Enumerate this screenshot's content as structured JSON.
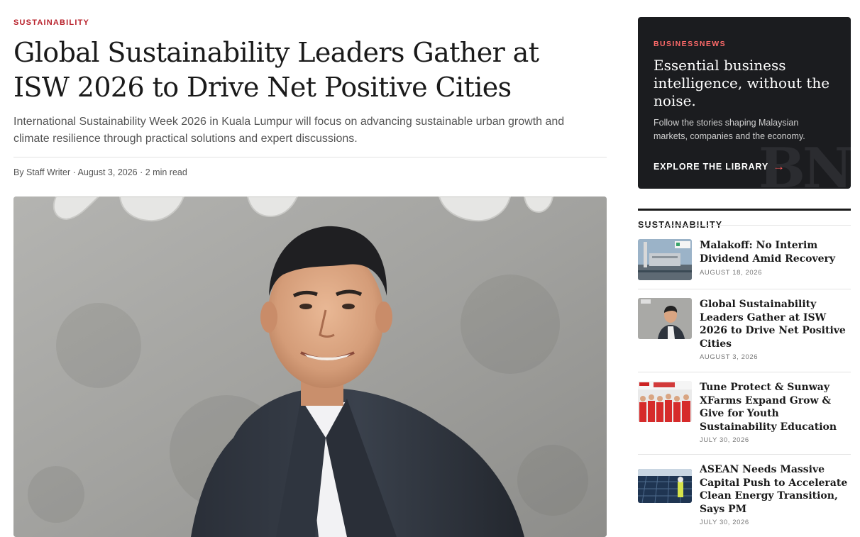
{
  "article": {
    "kicker": "SUSTAINABILITY",
    "headline": "Global Sustainability Leaders Gather at ISW 2026 to Drive Net Positive Cities",
    "dek": "International Sustainability Week 2026 in Kuala Lumpur will focus on advancing sustainable urban growth and climate resilience through practical solutions and expert discussions.",
    "byline": "By Staff Writer · August 3, 2026 · 2 min read"
  },
  "promo": {
    "brand": "BUSINESSNEWS",
    "title": "Essential business intelligence, without the noise.",
    "text": "Follow the stories shaping Malaysian markets, companies and the economy.",
    "cta": "EXPLORE THE LIBRARY",
    "cta_arrow": "→",
    "watermark": "BN"
  },
  "sidebar": {
    "section_label": "SUSTAINABILITY",
    "items": [
      {
        "title": "Malakoff: No Interim Dividend Amid Recovery",
        "date": "AUGUST 18, 2026"
      },
      {
        "title": "Global Sustainability Leaders Gather at ISW 2026 to Drive Net Positive Cities",
        "date": "AUGUST 3, 2026"
      },
      {
        "title": "Tune Protect & Sunway XFarms Expand Grow & Give for Youth Sustainability Education",
        "date": "JULY 30, 2026"
      },
      {
        "title": "ASEAN Needs Massive Capital Push to Accelerate Clean Energy Transition, Says PM",
        "date": "JULY 30, 2026"
      }
    ]
  },
  "colors": {
    "accent": "#b8202a",
    "promo_bg": "#1b1c1f",
    "promo_accent": "#ff6a6a"
  }
}
